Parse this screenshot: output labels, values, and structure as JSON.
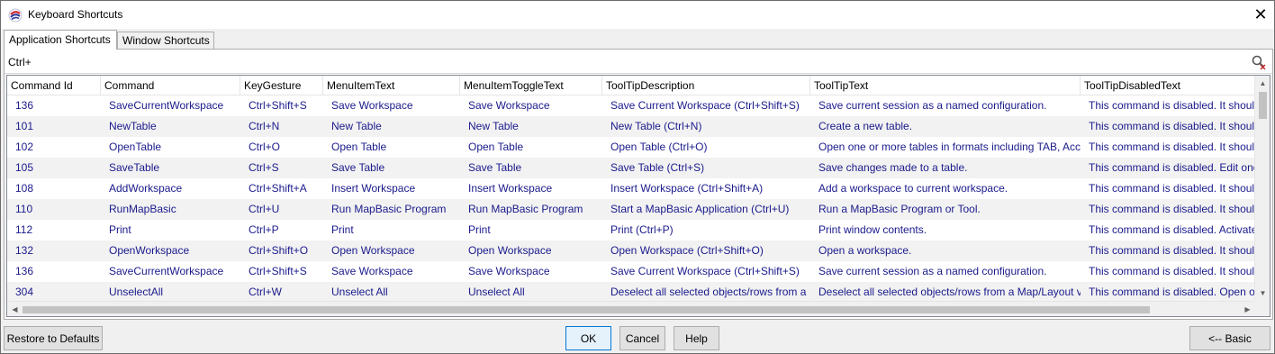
{
  "window": {
    "title": "Keyboard Shortcuts",
    "icon": "app-logo-icon",
    "close_glyph": "✕"
  },
  "tabs": [
    {
      "label": "Application Shortcuts",
      "active": true
    },
    {
      "label": "Window Shortcuts",
      "active": false
    }
  ],
  "search": {
    "value": "Ctrl+",
    "icon": "search-clear-icon"
  },
  "table": {
    "columns": [
      "Command Id",
      "Command",
      "KeyGesture",
      "MenuItemText",
      "MenuItemToggleText",
      "ToolTipDescription",
      "ToolTipText",
      "ToolTipDisabledText"
    ],
    "rows": [
      [
        "136",
        "SaveCurrentWorkspace",
        "Ctrl+Shift+S",
        "Save Workspace",
        "Save Workspace",
        "Save Current Workspace (Ctrl+Shift+S)",
        "Save current session as a named configuration.",
        "This command is disabled. It should"
      ],
      [
        "101",
        "NewTable",
        "Ctrl+N",
        "New Table",
        "New Table",
        "New Table (Ctrl+N)",
        "Create a new table.",
        "This command is disabled. It should"
      ],
      [
        "102",
        "OpenTable",
        "Ctrl+O",
        "Open Table",
        "Open Table",
        "Open Table (Ctrl+O)",
        "Open one or more tables in formats including TAB, Acc",
        "This command is disabled. It should"
      ],
      [
        "105",
        "SaveTable",
        "Ctrl+S",
        "Save Table",
        "Save Table",
        "Save Table (Ctrl+S)",
        "Save changes made to a table.",
        "This command is disabled. Edit one"
      ],
      [
        "108",
        "AddWorkspace",
        "Ctrl+Shift+A",
        "Insert Workspace",
        "Insert Workspace",
        "Insert Workspace (Ctrl+Shift+A)",
        "Add a workspace to current workspace.",
        "This command is disabled. It should"
      ],
      [
        "110",
        "RunMapBasic",
        "Ctrl+U",
        "Run MapBasic Program",
        "Run MapBasic Program",
        "Start a MapBasic Application (Ctrl+U)",
        "Run a MapBasic Program or Tool.",
        "This command is disabled. It should"
      ],
      [
        "112",
        "Print",
        "Ctrl+P",
        "Print",
        "Print",
        "Print (Ctrl+P)",
        "Print window contents.",
        "This command is disabled. Activate"
      ],
      [
        "132",
        "OpenWorkspace",
        "Ctrl+Shift+O",
        "Open Workspace",
        "Open Workspace",
        "Open Workspace (Ctrl+Shift+O)",
        "Open a workspace.",
        "This command is disabled. It should"
      ],
      [
        "136",
        "SaveCurrentWorkspace",
        "Ctrl+Shift+S",
        "Save Workspace",
        "Save Workspace",
        "Save Current Workspace (Ctrl+Shift+S)",
        "Save current session as a named configuration.",
        "This command is disabled. It should"
      ],
      [
        "304",
        "UnselectAll",
        "Ctrl+W",
        "Unselect All",
        "Unselect All",
        "Deselect all selected objects/rows from a",
        "Deselect all selected objects/rows from a Map/Layout v",
        "This command is disabled. Open on"
      ]
    ]
  },
  "buttons": {
    "restore": "Restore to Defaults",
    "ok": "OK",
    "cancel": "Cancel",
    "help": "Help",
    "basic": "<-- Basic"
  },
  "colors": {
    "cell_text": "#1a1a8c",
    "alt_row": "#f2f2f2",
    "default_button_border": "#0078d7"
  }
}
